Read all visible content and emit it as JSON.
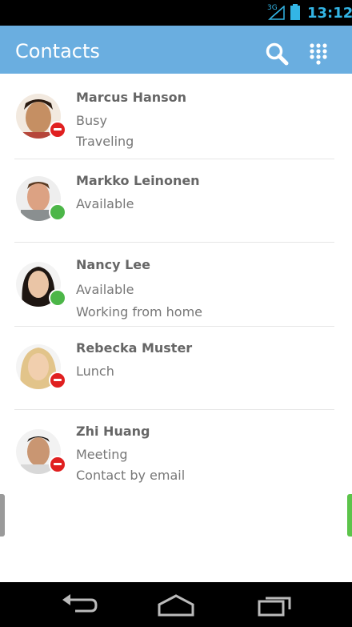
{
  "statusbar": {
    "network": "3G",
    "time": "13:12"
  },
  "appbar": {
    "title": "Contacts",
    "search_icon": "search-icon",
    "dialpad_icon": "dialpad-icon"
  },
  "contacts": [
    {
      "name": "Marcus Hanson",
      "status": "Busy",
      "note": "Traveling",
      "presence": "busy"
    },
    {
      "name": "Markko Leinonen",
      "status": "Available",
      "note": "",
      "presence": "available"
    },
    {
      "name": "Nancy Lee",
      "status": "Available",
      "note": "Working from home",
      "presence": "available"
    },
    {
      "name": "Rebecka Muster",
      "status": "Lunch",
      "note": "",
      "presence": "busy"
    },
    {
      "name": "Zhi Huang",
      "status": "Meeting",
      "note": "Contact by email",
      "presence": "busy"
    }
  ],
  "colors": {
    "appbar": "#6aaee0",
    "busy": "#e02020",
    "available": "#4cb648",
    "status_accent": "#33b5e5"
  },
  "navbar": {
    "back_icon": "back-icon",
    "home_icon": "home-icon",
    "recents_icon": "recents-icon"
  }
}
